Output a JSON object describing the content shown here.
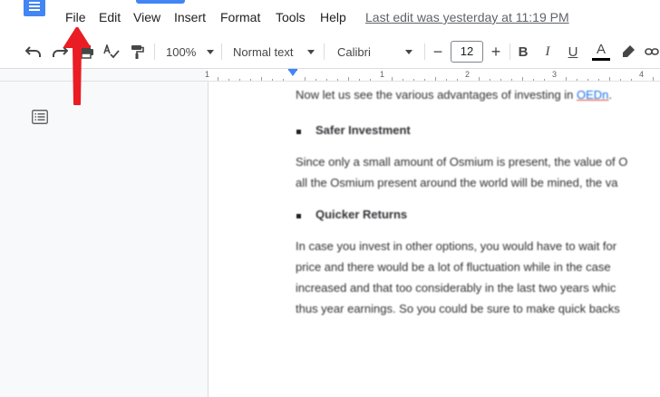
{
  "menubar": {
    "items": [
      "File",
      "Edit",
      "View",
      "Insert",
      "Format",
      "Tools",
      "Help"
    ],
    "last_edit": "Last edit was yesterday at 11:19 PM"
  },
  "toolbar": {
    "zoom": "100%",
    "style": "Normal text",
    "font": "Calibri",
    "font_size": "12",
    "decrease_label": "−",
    "increase_label": "+",
    "bold_label": "B",
    "italic_label": "I",
    "underline_label": "U",
    "text_color_label": "A"
  },
  "ruler": {
    "numbers": [
      "1",
      "1",
      "2",
      "3",
      "4"
    ]
  },
  "document": {
    "lines": [
      {
        "text": "Now let us see the various advantages of investing in ",
        "link": "OEDn",
        "tail": "."
      },
      {
        "text": "Safer Investment",
        "bullet": true,
        "bold": true
      },
      {
        "text": "Since only a small amount of Osmium is present, the value of O"
      },
      {
        "text": "all the Osmium present around the world will be mined, the va"
      },
      {
        "text": "Quicker Returns",
        "bullet": true,
        "bold": true
      },
      {
        "text": "In case you invest in other options, you would have to wait for"
      },
      {
        "text": "price and there would be a lot of fluctuation while in the case"
      },
      {
        "text": "increased and that too considerably in the last two years whic"
      },
      {
        "text": "thus year earnings. So you could be sure to make quick backs"
      }
    ]
  },
  "colors": {
    "accent": "#4285f4",
    "arrow": "#ea1c24",
    "text_color_underline": "#000000"
  }
}
